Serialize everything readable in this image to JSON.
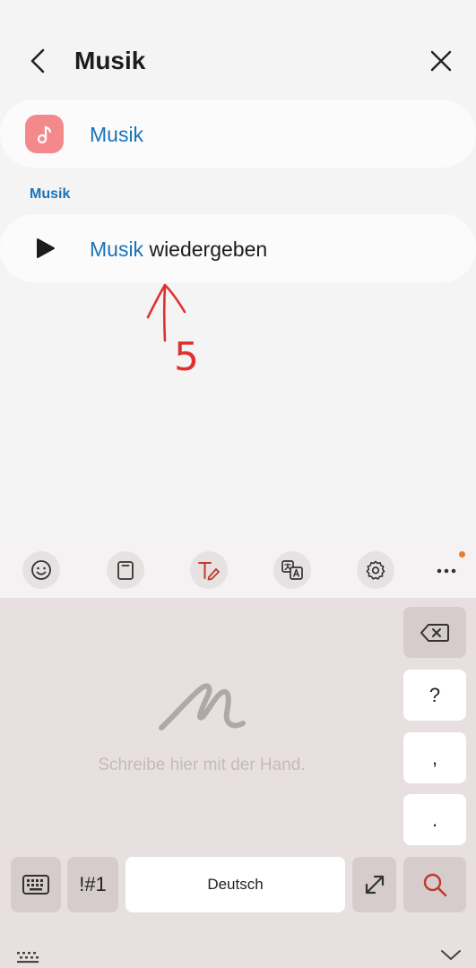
{
  "header": {
    "title": "Musik"
  },
  "app_result": {
    "label": "Musik"
  },
  "section": {
    "label": "Musik"
  },
  "action_result": {
    "highlight": "Musik",
    "rest": " wiedergeben"
  },
  "annotation": {
    "number": "5"
  },
  "toolbar": {
    "icons": [
      "emoji-icon",
      "clipboard-icon",
      "handwriting-icon",
      "translate-icon",
      "settings-icon",
      "more-icon"
    ],
    "accent": "#c0392b",
    "notify_color": "#f07a24"
  },
  "keyboard": {
    "handwriting_hint": "Schreibe hier mit der Hand.",
    "keys": {
      "question": "?",
      "comma": ",",
      "period": ".",
      "symbols": "!#1",
      "space": "Deutsch"
    }
  },
  "colors": {
    "link": "#1a73b8",
    "app_icon_bg": "#f4898c"
  }
}
